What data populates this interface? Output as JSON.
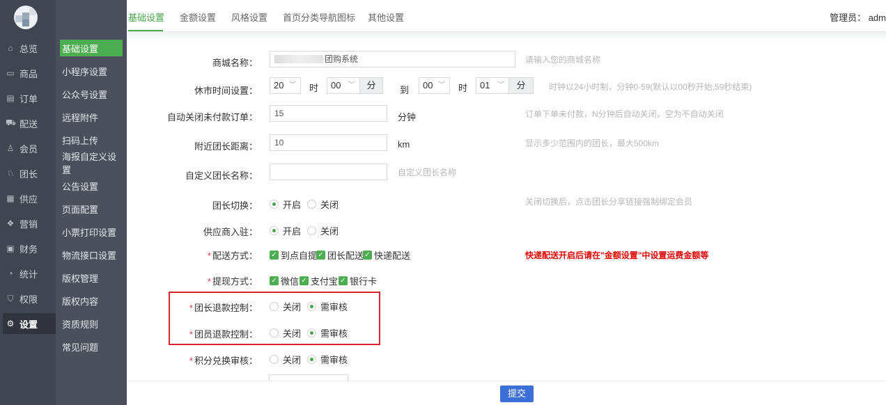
{
  "nav_primary": [
    {
      "label": "总览",
      "icon": "home-icon"
    },
    {
      "label": "商品",
      "icon": "goods-icon"
    },
    {
      "label": "订单",
      "icon": "order-icon"
    },
    {
      "label": "配送",
      "icon": "truck-icon"
    },
    {
      "label": "会员",
      "icon": "user-icon"
    },
    {
      "label": "团长",
      "icon": "leader-icon"
    },
    {
      "label": "供应",
      "icon": "supply-icon"
    },
    {
      "label": "营销",
      "icon": "gift-icon"
    },
    {
      "label": "财务",
      "icon": "finance-icon"
    },
    {
      "label": "统计",
      "icon": "stats-icon"
    },
    {
      "label": "权限",
      "icon": "shield-icon"
    },
    {
      "label": "设置",
      "icon": "gear-icon"
    }
  ],
  "nav_secondary": [
    "基础设置",
    "小程序设置",
    "公众号设置",
    "远程附件",
    "扫码上传",
    "海报自定义设置",
    "公告设置",
    "页面配置",
    "小票打印设置",
    "物流接口设置",
    "版权管理",
    "版权内容",
    "资质规则",
    "常见问题"
  ],
  "tabs": [
    "基础设置",
    "金额设置",
    "风格设置",
    "首页分类导航图标",
    "其他设置"
  ],
  "admin_label": "管理员： adm",
  "form": {
    "shop_name": {
      "label": "商城名称：",
      "value": "团购系统",
      "hint": "请输入您的商城名称"
    },
    "closing_time": {
      "label": "休市时间设置：",
      "from_hour": "20",
      "hour_unit": "时",
      "from_min": "00",
      "min_unit": "分",
      "to": "到",
      "to_hour": "00",
      "to_min": "01",
      "hint": "时钟以24小时制，分钟0-59(默认以00秒开始,59秒结束)"
    },
    "auto_close": {
      "label": "自动关闭未付款订单：",
      "value": "15",
      "unit": "分钟",
      "hint": "订单下单未付款，N分钟后自动关闭，空为不自动关闭"
    },
    "distance": {
      "label": "附近团长距离：",
      "value": "10",
      "unit": "km",
      "hint": "显示多少范围内的团长，最大500km"
    },
    "leader_name": {
      "label": "自定义团长名称：",
      "value": "",
      "hint": "自定义团长名称"
    },
    "leader_switch": {
      "label": "团长切换：",
      "on": "开启",
      "off": "关闭",
      "hint": "关闭切换后，点击团长分享链接强制绑定会员"
    },
    "supplier": {
      "label": "供应商入驻：",
      "on": "开启",
      "off": "关闭"
    },
    "delivery": {
      "label": "配送方式：",
      "options": [
        "到点自提",
        "团长配送",
        "快递配送"
      ],
      "warning": "快递配送开启后请在\"金额设置\"中设置运费金额等"
    },
    "withdraw": {
      "label": "提现方式：",
      "options": [
        "微信",
        "支付宝",
        "银行卡"
      ]
    },
    "leader_refund": {
      "label": "团长退款控制：",
      "off": "关闭",
      "audit": "需审核"
    },
    "member_refund": {
      "label": "团员退款控制：",
      "off": "关闭",
      "audit": "需审核"
    },
    "points_audit": {
      "label": "积分兑换审核：",
      "off": "关闭",
      "audit": "需审核"
    }
  },
  "submit_label": "提交",
  "colors": {
    "accent": "#44a748",
    "submit": "#3d6fd8",
    "warning": "#e60000",
    "highlight_box": "#d7262e"
  }
}
